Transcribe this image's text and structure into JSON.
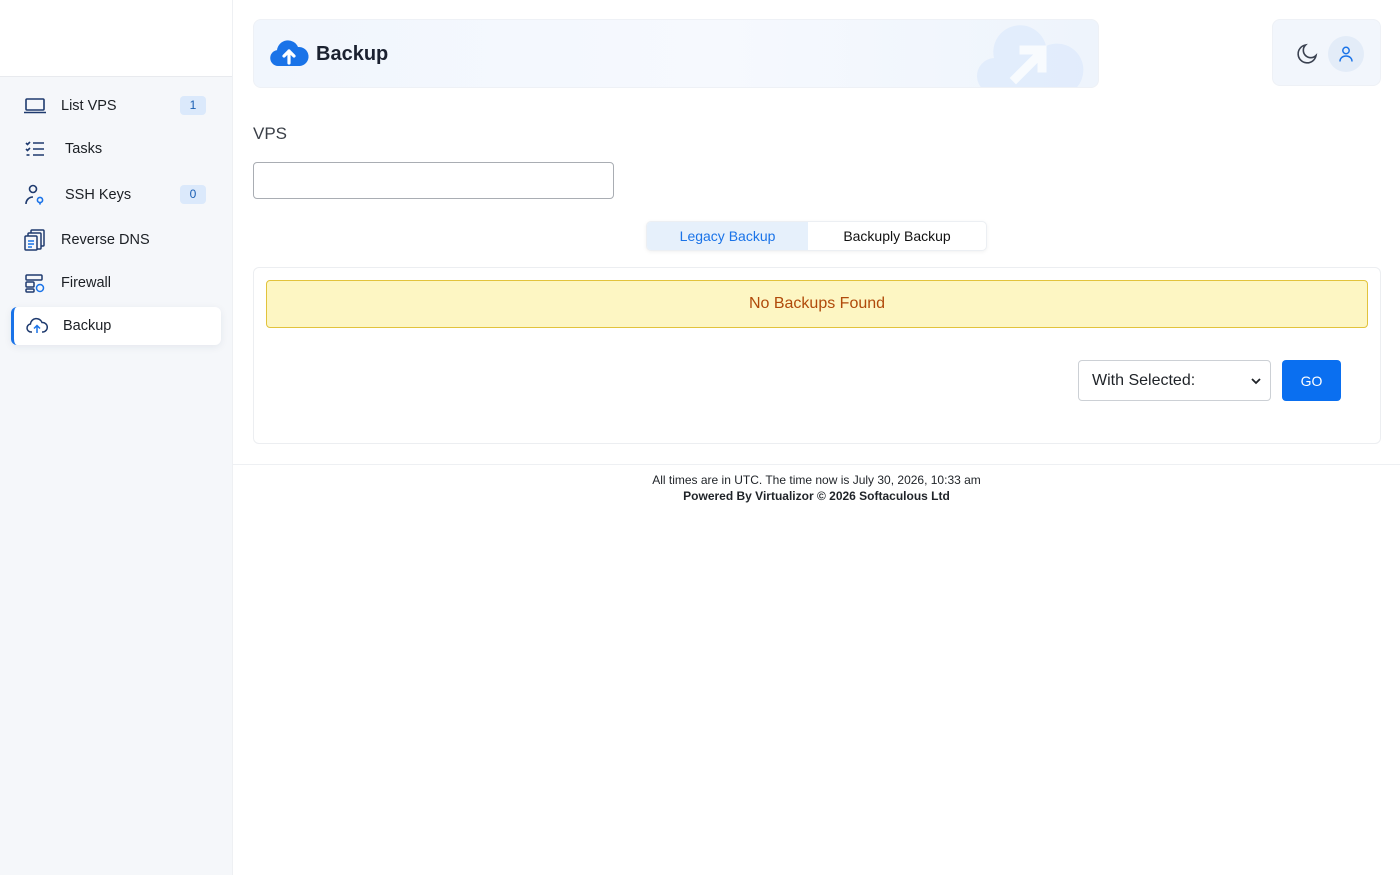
{
  "sidebar": {
    "items": [
      {
        "label": "List VPS",
        "icon": "laptop-icon",
        "badge": "1"
      },
      {
        "label": "Tasks",
        "icon": "task-list-icon"
      },
      {
        "label": "SSH Keys",
        "icon": "user-key-icon",
        "badge": "0"
      },
      {
        "label": "Reverse DNS",
        "icon": "documents-icon"
      },
      {
        "label": "Firewall",
        "icon": "firewall-icon"
      },
      {
        "label": "Backup",
        "icon": "cloud-upload-icon",
        "active": true
      }
    ]
  },
  "header": {
    "title": "Backup",
    "icon": "cloud-upload-icon"
  },
  "topbar": {
    "theme_icon": "moon-icon",
    "user_icon": "user-icon"
  },
  "vps": {
    "label": "VPS",
    "value": ""
  },
  "tabs": [
    {
      "label": "Legacy Backup",
      "active": true
    },
    {
      "label": "Backuply Backup",
      "active": false
    }
  ],
  "panel": {
    "alert_text": "No Backups Found",
    "select_value": "With Selected:",
    "go_label": "GO"
  },
  "footer": {
    "line1": "All times are in UTC. The time now is July 30, 2026, 10:33 am",
    "line2": "Powered By Virtualizor © 2026 Softaculous Ltd"
  },
  "colors": {
    "accent": "#1a73e8",
    "button": "#0a6ff0",
    "alert_bg": "#fdf6c3",
    "alert_border": "#e2c33c",
    "alert_text": "#b04a0a",
    "sidebar_bg": "#f5f7fa"
  }
}
